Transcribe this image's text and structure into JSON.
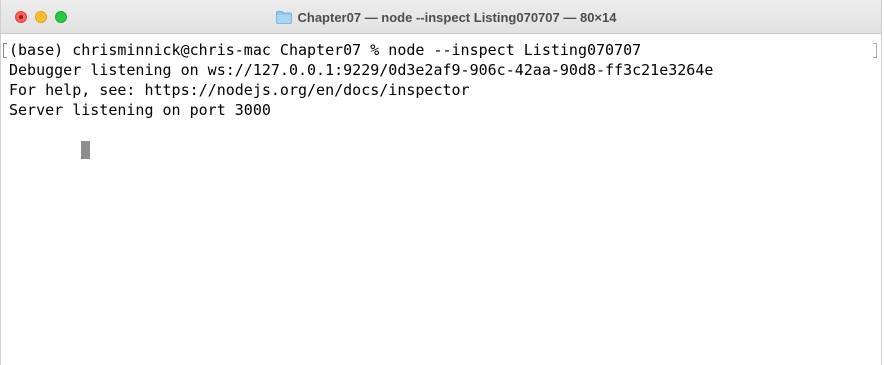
{
  "window": {
    "title": "Chapter07 — node --inspect Listing070707 — 80×14",
    "folder_icon": "folder-icon",
    "traffic_lights": {
      "close_color": "#fe5f57",
      "minimize_color": "#febc2e",
      "maximize_color": "#28c840"
    }
  },
  "terminal": {
    "lines": [
      "(base) chrisminnick@chris-mac Chapter07 % node --inspect Listing070707",
      "Debugger listening on ws://127.0.0.1:9229/0d3e2af9-906c-42aa-90d8-ff3c21e3264e",
      "For help, see: https://nodejs.org/en/docs/inspector",
      "Server listening on port 3000"
    ],
    "cursor_color": "#8e8e8e",
    "background_color": "#ffffff",
    "text_color": "#000000"
  }
}
